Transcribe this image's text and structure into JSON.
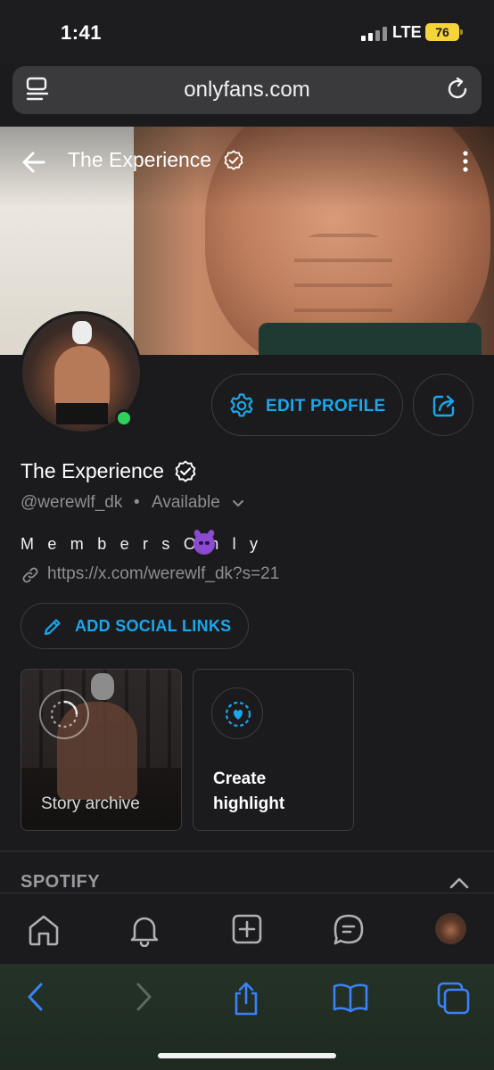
{
  "status_bar": {
    "time": "1:41",
    "network": "LTE",
    "battery": "76"
  },
  "browser": {
    "url": "onlyfans.com"
  },
  "profile": {
    "header_title": "The Experience",
    "name": "The Experience",
    "handle": "@werewlf_dk",
    "separator": "•",
    "status": "Available",
    "bio": "M e m b e r s O n l y",
    "link": "https://x.com/werewlf_dk?s=21",
    "edit_profile_label": "EDIT PROFILE",
    "add_social_links_label": "ADD SOCIAL LINKS"
  },
  "highlights": {
    "story_archive_label": "Story archive",
    "create_highlight_line1": "Create",
    "create_highlight_line2": "highlight"
  },
  "sections": {
    "spotify_title": "SPOTIFY"
  },
  "icons": {
    "back": "arrow-left-icon",
    "more": "kebab-icon",
    "verified": "verified-badge-icon",
    "gear": "gear-icon",
    "share": "share-icon",
    "link": "link-icon",
    "pencil": "pencil-icon",
    "home": "home-icon",
    "bell": "bell-icon",
    "add": "plus-square-icon",
    "messages": "chat-icon",
    "safari_back": "chevron-left-icon",
    "safari_forward": "chevron-right-icon",
    "safari_share": "share-icon",
    "bookmarks": "book-icon",
    "tabs": "tabs-icon"
  },
  "colors": {
    "accent": "#1aa7ec",
    "background": "#1b1b1d",
    "online": "#2bd35a",
    "battery": "#f5d33a",
    "safari_blue": "#3b82f6"
  }
}
